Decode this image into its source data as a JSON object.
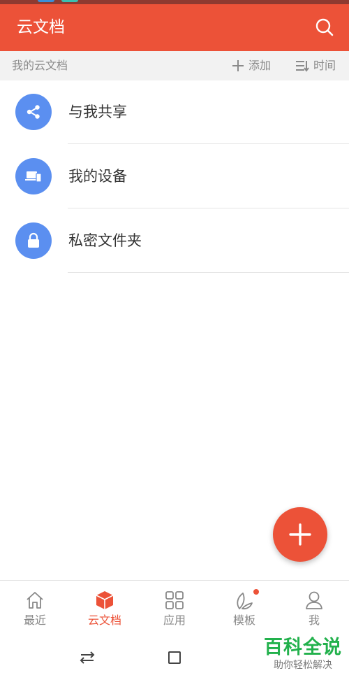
{
  "colors": {
    "brand": "#ec5238",
    "accent_blue": "#5b8ff0",
    "watermark": "#22b14c"
  },
  "header": {
    "title": "云文档",
    "search_icon": "search-icon"
  },
  "subbar": {
    "label": "我的云文档",
    "add_label": "添加",
    "sort_label": "时间"
  },
  "items": [
    {
      "label": "与我共享",
      "icon": "share-icon"
    },
    {
      "label": "我的设备",
      "icon": "devices-icon"
    },
    {
      "label": "私密文件夹",
      "icon": "lock-icon"
    }
  ],
  "fab": {
    "icon": "plus-icon"
  },
  "tabs": [
    {
      "label": "最近",
      "icon": "home-icon",
      "active": false
    },
    {
      "label": "云文档",
      "icon": "cube-icon",
      "active": true
    },
    {
      "label": "应用",
      "icon": "grid-icon",
      "active": false
    },
    {
      "label": "模板",
      "icon": "leaf-icon",
      "active": false,
      "badge": true
    },
    {
      "label": "我",
      "icon": "person-icon",
      "active": false
    }
  ],
  "watermark": {
    "line1": "百科全说",
    "line2": "助你轻松解决"
  }
}
